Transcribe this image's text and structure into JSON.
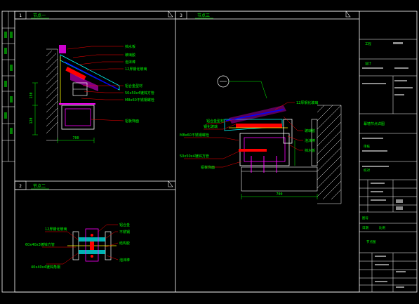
{
  "panels": [
    {
      "num": "1",
      "title": "节点一"
    },
    {
      "num": "2",
      "title": "节点二"
    },
    {
      "num": "3",
      "title": "节点三"
    }
  ],
  "detail1": {
    "callouts": [
      "挡水板",
      "玻璃胶",
      "泡沫棒",
      "12厚钢化玻璃",
      "铝合金型材",
      "50x50x4镀锌方管",
      "M8x60不锈钢螺栓",
      "铝板饰面"
    ],
    "dims": [
      "700",
      "150",
      "120"
    ]
  },
  "detail2": {
    "callouts_left": [
      "12厚钢化玻璃",
      "60x40x3镀锌方管",
      "40x40x4镀锌角钢"
    ],
    "callouts_right": [
      "铝合金",
      "不锈钢",
      "结构胶",
      "泡沫棒"
    ]
  },
  "detail3": {
    "callouts_left": [
      "铝合金型材",
      "钢化玻璃",
      "M8x60不锈钢螺栓",
      "50x50x4镀锌方管",
      "铝板饰面"
    ],
    "callouts_right": [
      "12厚钢化玻璃",
      "玻璃胶",
      "泡沫棒",
      "挡水板"
    ],
    "dim": "700"
  },
  "title_block": {
    "texts": [
      "工程",
      "设计",
      "幕墙节点详图",
      "审核",
      "校对",
      "图号",
      "日期",
      "比例",
      "节点图"
    ]
  },
  "colors": {
    "frame": "#ffffff",
    "annotation": "#00ff00",
    "highlight": "#ff0000",
    "glass": "#00ffff",
    "structure": "#ff00ff",
    "accent": "#ffff00",
    "secondary": "#0000ff"
  }
}
